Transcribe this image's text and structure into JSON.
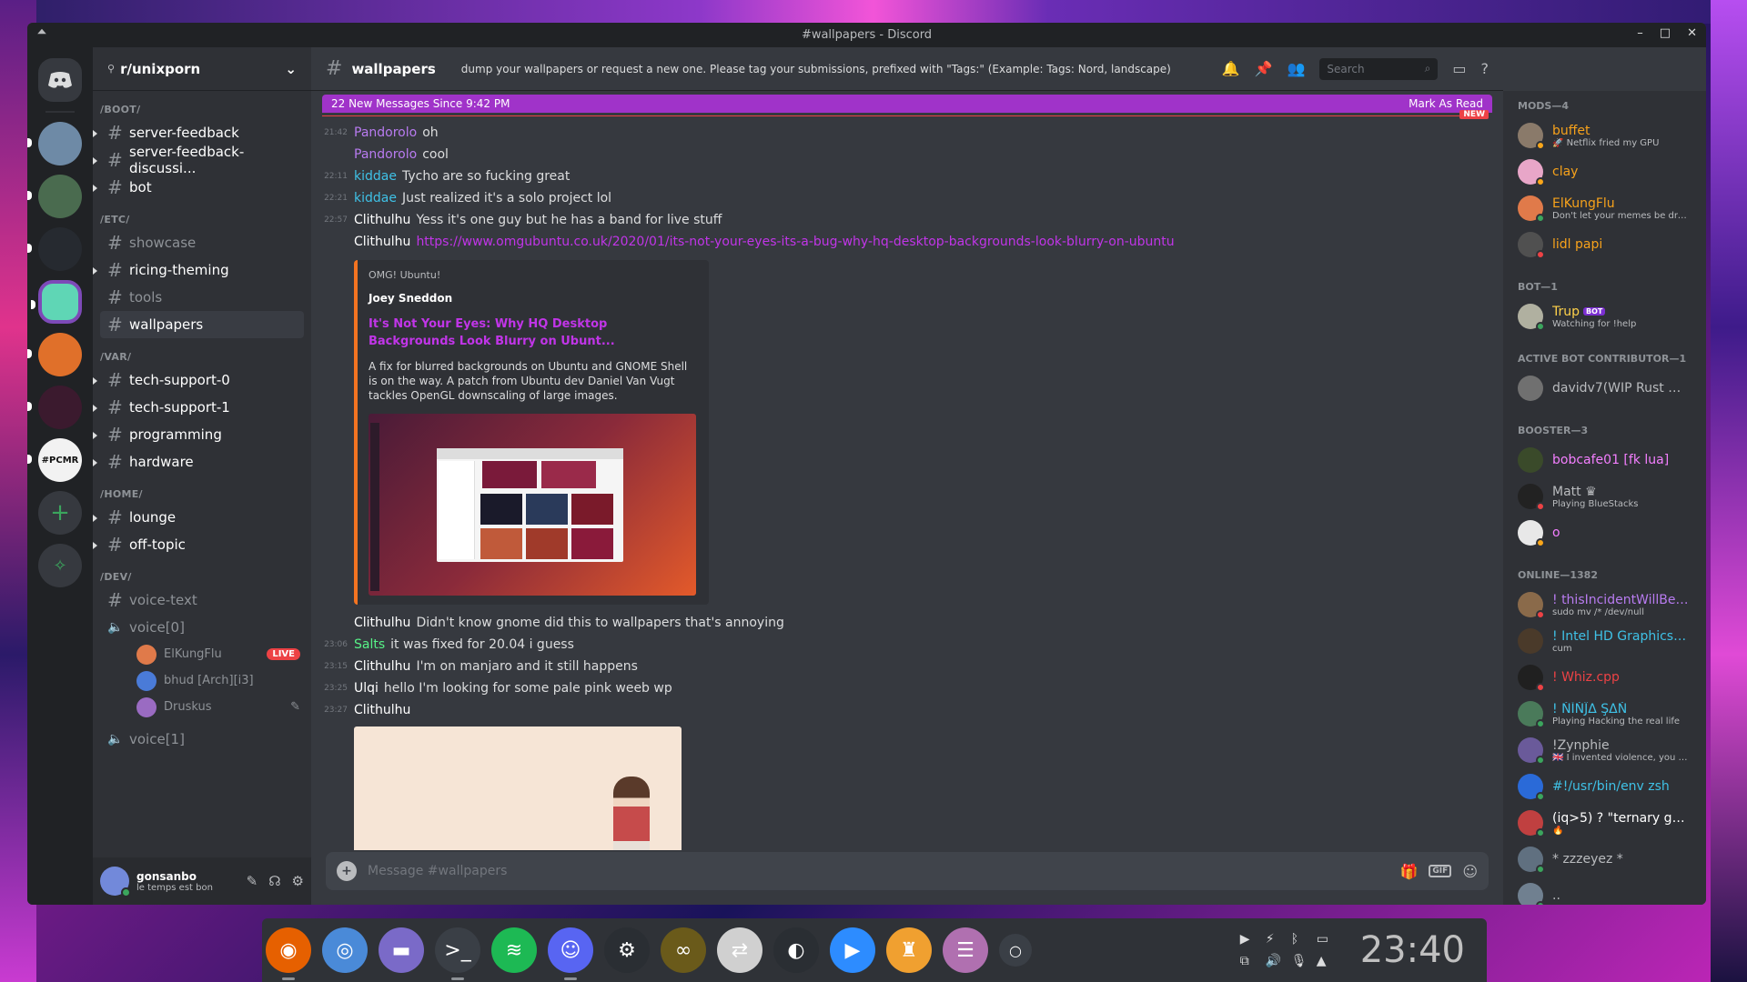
{
  "window": {
    "title": "#wallpapers - Discord",
    "controls": [
      "–",
      "□",
      "✕"
    ]
  },
  "servers": {
    "items": [
      {
        "name": "home",
        "color": "#36393f"
      },
      {
        "name": "tree",
        "color": "#6e8aa6"
      },
      {
        "name": "vanilla-tweaks",
        "color": "#4a6b4f"
      },
      {
        "name": "dark",
        "color": "#262a30"
      },
      {
        "name": "terminal",
        "color": "#5fd6b5"
      },
      {
        "name": "orange",
        "color": "#e0702a"
      },
      {
        "name": "pink",
        "color": "#3b1a2e"
      },
      {
        "name": "pcmr",
        "color": "#f2f2f2"
      }
    ],
    "pcmr_label": "#PCMR",
    "add": "+",
    "explore": "✧"
  },
  "guild": {
    "name": "r/unixporn",
    "icon": "⚲",
    "chevron": "⌄"
  },
  "categories": [
    {
      "name": "/BOOT/",
      "channels": [
        {
          "name": "server-feedback",
          "unread": true
        },
        {
          "name": "server-feedback-discussi...",
          "unread": true
        },
        {
          "name": "bot",
          "unread": true
        }
      ]
    },
    {
      "name": "/ETC/",
      "channels": [
        {
          "name": "showcase",
          "unread": false
        },
        {
          "name": "ricing-theming",
          "unread": true
        },
        {
          "name": "tools",
          "unread": false
        },
        {
          "name": "wallpapers",
          "unread": false,
          "active": true
        }
      ]
    },
    {
      "name": "/VAR/",
      "channels": [
        {
          "name": "tech-support-0",
          "unread": true
        },
        {
          "name": "tech-support-1",
          "unread": true
        },
        {
          "name": "programming",
          "unread": true
        },
        {
          "name": "hardware",
          "unread": true
        }
      ]
    },
    {
      "name": "/HOME/",
      "channels": [
        {
          "name": "lounge",
          "unread": true
        },
        {
          "name": "off-topic",
          "unread": true
        }
      ]
    },
    {
      "name": "/DEV/",
      "channels": [
        {
          "name": "voice-text",
          "unread": false
        }
      ]
    }
  ],
  "voice": {
    "channel0": "voice[0]",
    "users": [
      {
        "name": "ElKungFlu",
        "live": "LIVE",
        "color": "#e07a4a"
      },
      {
        "name": "bhud [Arch][i3]",
        "color": "#4a7bd8"
      },
      {
        "name": "Druskus",
        "color": "#9a6bc2",
        "icon": "✎"
      }
    ],
    "channel1": "voice[1]"
  },
  "user": {
    "name": "gonsanbo",
    "status": "le temps est bon",
    "icons": [
      "✎",
      "☊",
      "⚙"
    ]
  },
  "chat": {
    "channel": "wallpapers",
    "topic": "dump your wallpapers or request a new one. Please tag your submissions, prefixed with \"Tags:\" (Example: Tags: Nord, landscape)",
    "search": "Search",
    "new_messages": "22 New Messages Since 9:42 PM",
    "mark_read": "Mark As Read",
    "new_tag": "NEW",
    "messages": [
      {
        "ts": "21:42",
        "author": "Pandorolo",
        "color": "#b87bf0",
        "text": "oh"
      },
      {
        "ts": "",
        "author": "Pandorolo",
        "color": "#b87bf0",
        "text": "cool"
      },
      {
        "ts": "22:11",
        "author": "kiddae",
        "color": "#3fc1e6",
        "text": "Tycho are so fucking great"
      },
      {
        "ts": "22:21",
        "author": "kiddae",
        "color": "#3fc1e6",
        "text": "Just realized it's a solo project lol"
      },
      {
        "ts": "22:57",
        "author": "Clithulhu",
        "color": "#ffffff",
        "text": "Yess it's one guy but he has a band for live stuff"
      },
      {
        "ts": "",
        "author": "Clithulhu",
        "color": "#ffffff",
        "link": "https://www.omgubuntu.co.uk/2020/01/its-not-your-eyes-its-a-bug-why-hq-desktop-backgrounds-look-blurry-on-ubuntu"
      }
    ],
    "embed": {
      "provider": "OMG! Ubuntu!",
      "author": "Joey Sneddon",
      "title": "It's Not Your Eyes: Why HQ Desktop Backgrounds Look Blurry on Ubunt...",
      "description": "A fix for blurred backgrounds on Ubuntu and GNOME Shell is on the way. A patch from Ubuntu dev Daniel Van Vugt tackles OpenGL downscaling of large images."
    },
    "messages2": [
      {
        "ts": "",
        "author": "Clithulhu",
        "color": "#ffffff",
        "text": "Didn't know gnome did this to wallpapers that's annoying"
      },
      {
        "ts": "23:06",
        "author": "Salts",
        "color": "#57f287",
        "text": "it was fixed for 20.04 i guess"
      },
      {
        "ts": "23:15",
        "author": "Clithulhu",
        "color": "#ffffff",
        "text": "I'm on manjaro and it still happens"
      },
      {
        "ts": "23:25",
        "author": "Ulqi",
        "color": "#ffffff",
        "text": "hello I'm looking for some pale pink weeb wp"
      },
      {
        "ts": "23:27",
        "author": "Clithulhu",
        "color": "#ffffff",
        "text": ""
      }
    ],
    "composer_placeholder": "Message #wallpapers"
  },
  "members": {
    "groups": [
      {
        "title": "MODS—4",
        "items": [
          {
            "name": "buffet",
            "color": "#f7a21b",
            "sub": "🚀 Netflix fried my GPU",
            "av": "#8a7a6a",
            "st": "#faa61a"
          },
          {
            "name": "clay",
            "color": "#f7a21b",
            "sub": "",
            "av": "#e8a6c8",
            "st": "#faa61a"
          },
          {
            "name": "ElKungFlu",
            "color": "#f7a21b",
            "sub": "Don't let your memes be drea...",
            "av": "#e07a4a",
            "st": "#3ba55d"
          },
          {
            "name": "lidl papi",
            "color": "#f7a21b",
            "sub": "",
            "av": "#505050",
            "st": "#ed4245"
          }
        ]
      },
      {
        "title": "BOT—1",
        "items": [
          {
            "name": "Trup",
            "color": "#ffd24a",
            "bot": "BOT",
            "sub": "Watching for !help",
            "av": "#b0b0a0",
            "st": "#3ba55d"
          }
        ]
      },
      {
        "title": "ACTIVE BOT CONTRIBUTOR—1",
        "items": [
          {
            "name": "davidv7(WIP Rust Re...",
            "color": "#b9bbbe",
            "sub": "",
            "av": "#707070",
            "st": ""
          }
        ]
      },
      {
        "title": "BOOSTER—3",
        "items": [
          {
            "name": "bobcafe01 [fk lua]",
            "color": "#f47fff",
            "sub": "",
            "av": "#3a4a2a",
            "st": ""
          },
          {
            "name": "Matt ♛",
            "color": "#b9bbbe",
            "sub": "Playing BlueStacks",
            "av": "#222",
            "st": "#ed4245"
          },
          {
            "name": "o",
            "color": "#f47fff",
            "sub": "",
            "av": "#e8e8e8",
            "st": "#faa61a"
          }
        ]
      },
      {
        "title": "ONLINE—1382",
        "items": [
          {
            "name": "! thisIncidentWillBeRe...",
            "color": "#b87bf0",
            "sub": "sudo mv /* /dev/null",
            "av": "#8a6a4a",
            "st": "#ed4245"
          },
          {
            "name": "! Intel HD Graphics 60...",
            "color": "#3fc1e6",
            "sub": "cum",
            "av": "#4a3a2a",
            "st": ""
          },
          {
            "name": "! Whiz.cpp",
            "color": "#ed4245",
            "sub": "",
            "av": "#202020",
            "st": "#ed4245"
          },
          {
            "name": "! ŇĬŇĴΔ ŞΔŇ",
            "color": "#3fc1e6",
            "sub": "Playing Hacking the real life",
            "av": "#4a7a5a",
            "st": "#3ba55d"
          },
          {
            "name": "!Zynphie",
            "color": "#b9bbbe",
            "sub": "🇬🇧 I invented violence, you vil...",
            "av": "#6a5a9a",
            "st": "#3ba55d"
          },
          {
            "name": "#!/usr/bin/env zsh",
            "color": "#3fc1e6",
            "sub": "",
            "av": "#2a6ad8",
            "st": "#3ba55d"
          },
          {
            "name": "(iq>5) ? \"ternary gang...",
            "color": "#ffffff",
            "sub": "🔥",
            "av": "#c04040",
            "st": "#3ba55d"
          },
          {
            "name": "*    zzzeyez    *",
            "color": "#b9bbbe",
            "sub": "",
            "av": "#607080",
            "st": "#3ba55d"
          },
          {
            "name": "..",
            "color": "#b9bbbe",
            "sub": "",
            "av": "#708090",
            "st": "#3ba55d"
          }
        ]
      }
    ]
  },
  "dock": {
    "apps": [
      {
        "name": "firefox",
        "color": "#e66000",
        "glyph": "◉"
      },
      {
        "name": "chromium",
        "color": "#4a8ad8",
        "glyph": "◎"
      },
      {
        "name": "files",
        "color": "#7a6ac8",
        "glyph": "▬"
      },
      {
        "name": "terminal",
        "color": "#3a3f46",
        "glyph": ">_"
      },
      {
        "name": "spotify",
        "color": "#1db954",
        "glyph": "≋"
      },
      {
        "name": "discord",
        "color": "#5865f2",
        "glyph": "☺"
      },
      {
        "name": "steam",
        "color": "#2a2e33",
        "glyph": "⚙"
      },
      {
        "name": "infinity",
        "color": "#6a5a1a",
        "glyph": "∞"
      },
      {
        "name": "toggle",
        "color": "#d0d0d0",
        "glyph": "⇄"
      },
      {
        "name": "obs",
        "color": "#2a2e33",
        "glyph": "◐"
      },
      {
        "name": "zoom",
        "color": "#2d8cff",
        "glyph": "▶"
      },
      {
        "name": "joystick",
        "color": "#f0a030",
        "glyph": "♜"
      },
      {
        "name": "notes",
        "color": "#b070b0",
        "glyph": "☰"
      },
      {
        "name": "dot",
        "color": "#3a3f46",
        "glyph": "○"
      }
    ],
    "tray": [
      "▶",
      "⚡",
      "ᛒ",
      "▭",
      "⧉",
      "🔊",
      "🎙",
      "▲"
    ],
    "clock": "23:40"
  }
}
